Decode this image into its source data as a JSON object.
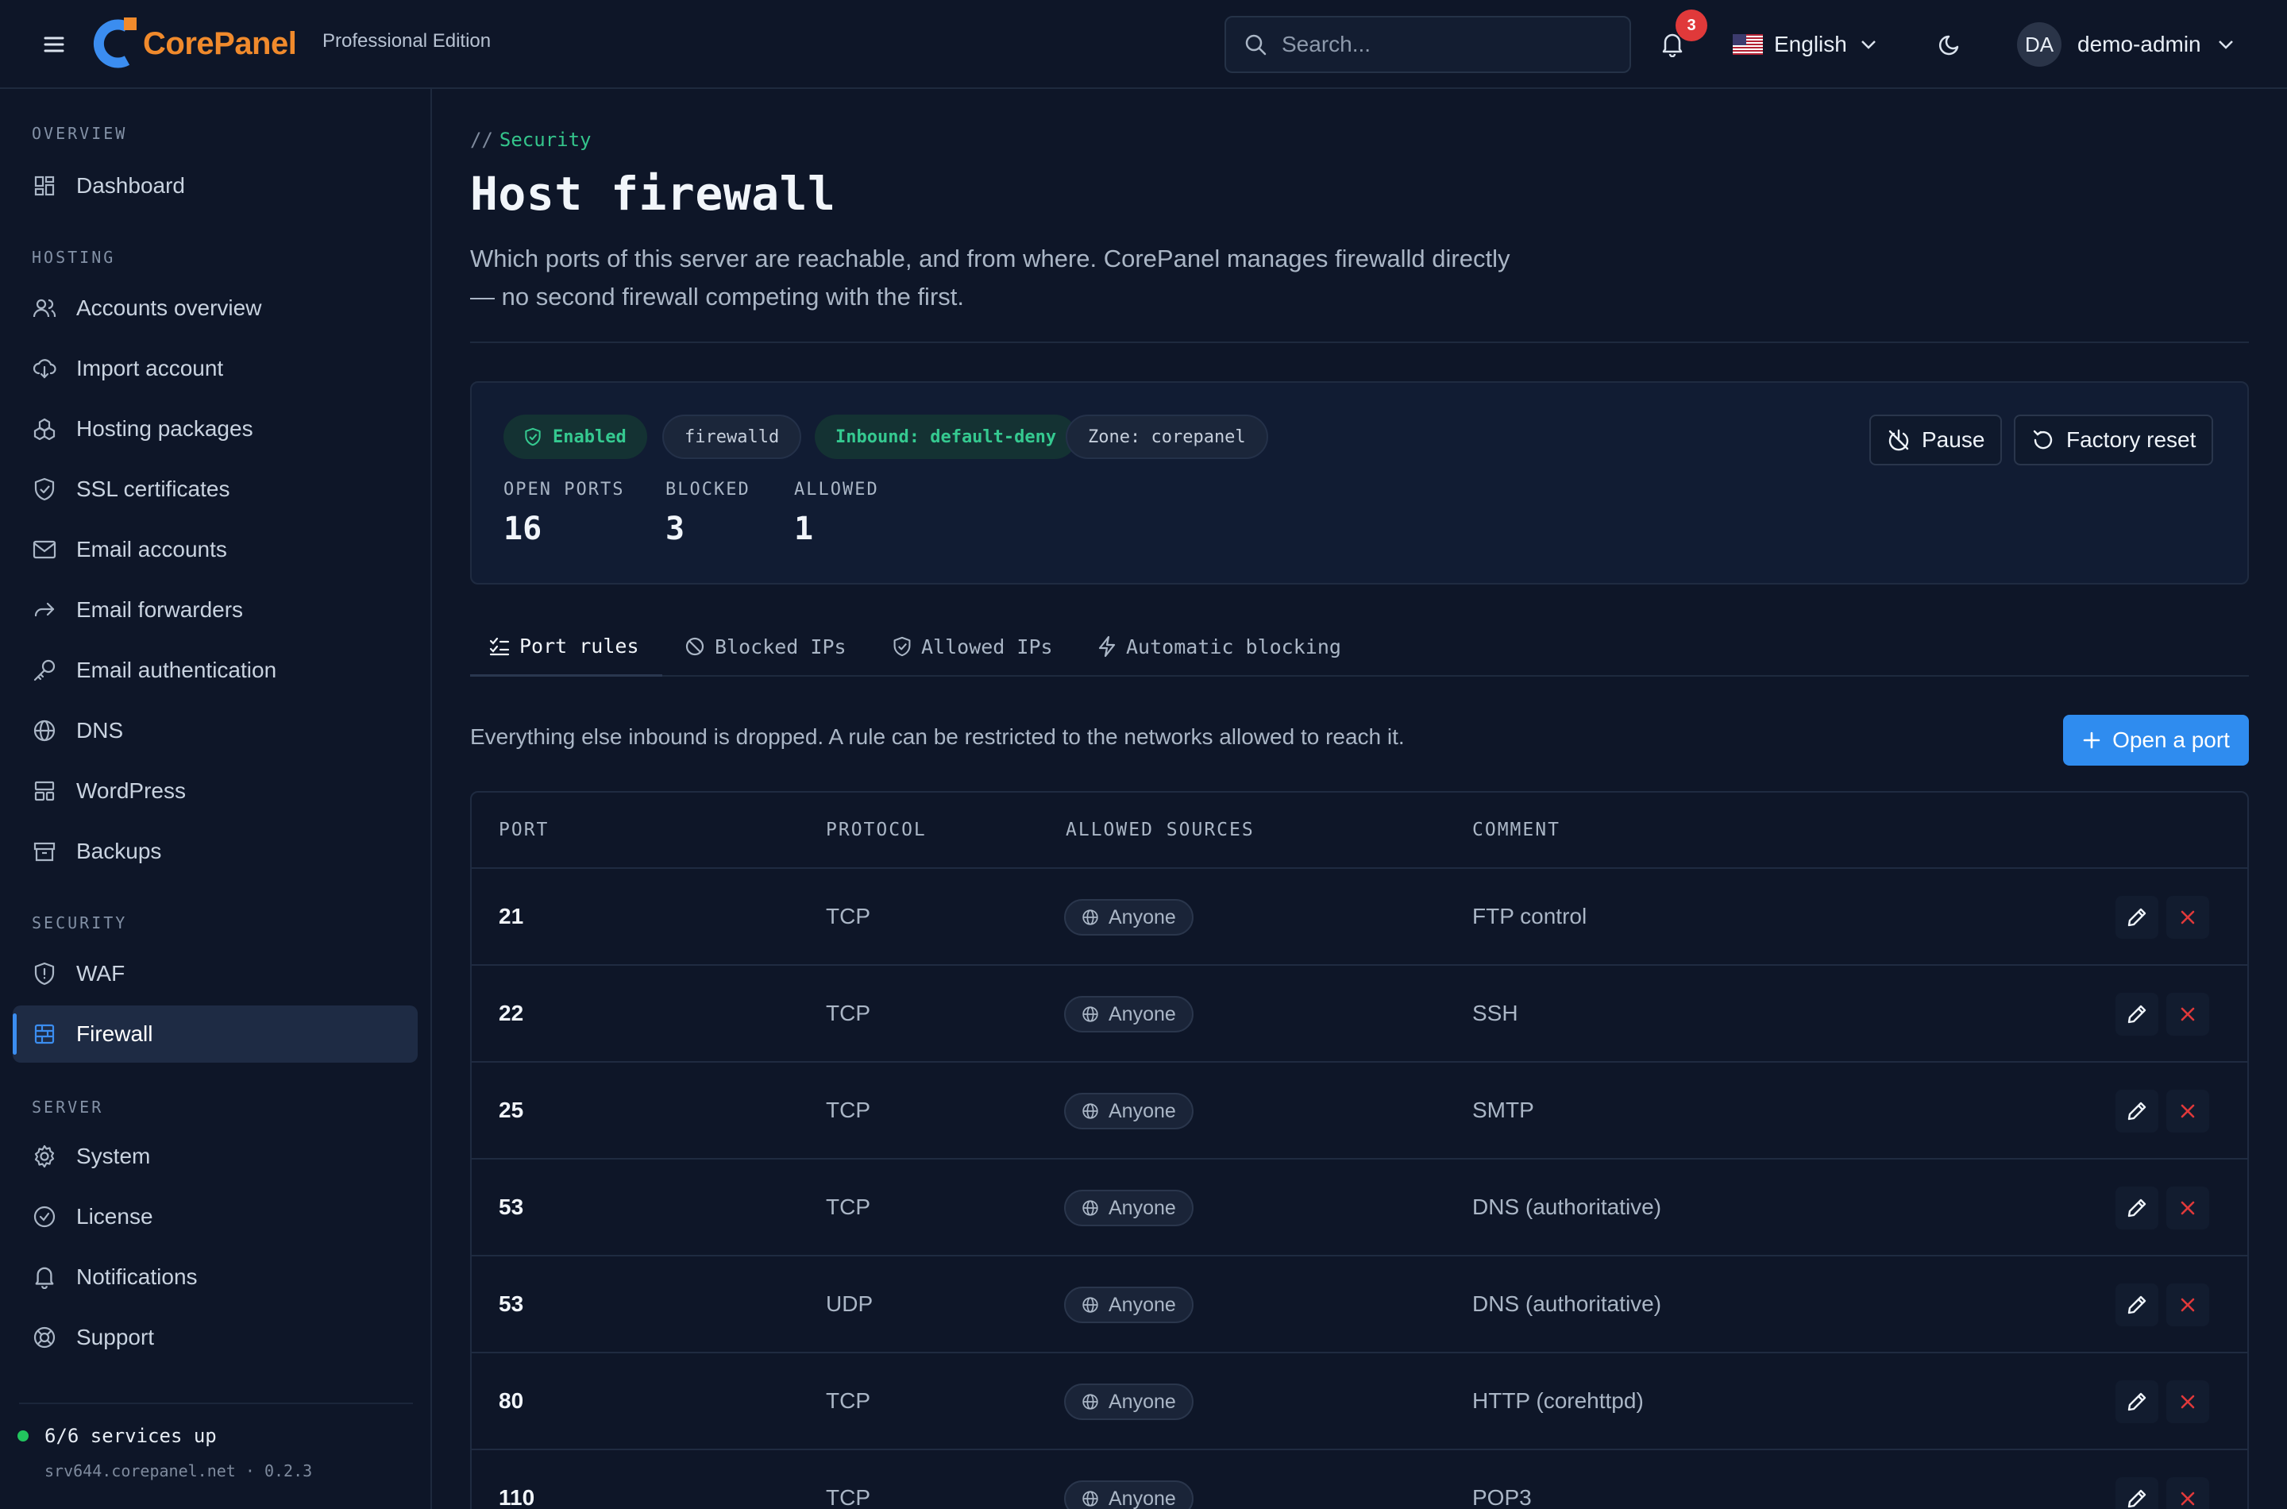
{
  "header": {
    "brand": "CorePanel",
    "edition": "Professional Edition",
    "search_placeholder": "Search...",
    "notifications_count": "3",
    "language": "English",
    "user_initials": "DA",
    "user_name": "demo-admin",
    "colors": {
      "brand_orange": "#f08a2c",
      "brand_blue": "#3b8df0",
      "badge_red": "#e0393a"
    }
  },
  "sidebar": {
    "sections": [
      {
        "title": "OVERVIEW",
        "items": [
          {
            "label": "Dashboard",
            "icon": "dashboard-icon"
          }
        ]
      },
      {
        "title": "HOSTING",
        "items": [
          {
            "label": "Accounts overview",
            "icon": "users-icon"
          },
          {
            "label": "Import account",
            "icon": "cloud-download-icon"
          },
          {
            "label": "Hosting packages",
            "icon": "packages-icon"
          },
          {
            "label": "SSL certificates",
            "icon": "shield-icon"
          },
          {
            "label": "Email accounts",
            "icon": "mail-icon"
          },
          {
            "label": "Email forwarders",
            "icon": "forward-arrow-icon"
          },
          {
            "label": "Email authentication",
            "icon": "key-icon"
          },
          {
            "label": "DNS",
            "icon": "globe-icon"
          },
          {
            "label": "WordPress",
            "icon": "layout-icon"
          },
          {
            "label": "Backups",
            "icon": "archive-icon"
          }
        ]
      },
      {
        "title": "SECURITY",
        "items": [
          {
            "label": "WAF",
            "icon": "shield-alert-icon"
          },
          {
            "label": "Firewall",
            "icon": "brick-wall-icon",
            "active": true
          }
        ]
      },
      {
        "title": "SERVER",
        "items": [
          {
            "label": "System",
            "icon": "gear-icon"
          },
          {
            "label": "License",
            "icon": "check-circle-icon"
          },
          {
            "label": "Notifications",
            "icon": "bell-icon"
          },
          {
            "label": "Support",
            "icon": "lifebuoy-icon"
          }
        ]
      }
    ],
    "status": "6/6 services up",
    "host": "srv644.corepanel.net",
    "host_sep": "·",
    "version": "0.2.3"
  },
  "page": {
    "breadcrumb_prefix": "//",
    "breadcrumb": "Security",
    "title": "Host firewall",
    "description": "Which ports of this server are reachable, and from where. CorePanel manages firewalld directly — no second firewall competing with the first."
  },
  "status_card": {
    "chips": {
      "enabled": "Enabled",
      "backend": "firewalld",
      "inbound": "Inbound: default-deny",
      "zone": "Zone: corepanel"
    },
    "stats": [
      {
        "label": "OPEN PORTS",
        "value": "16"
      },
      {
        "label": "BLOCKED",
        "value": "3"
      },
      {
        "label": "ALLOWED",
        "value": "1"
      }
    ],
    "buttons": {
      "pause": "Pause",
      "factory_reset": "Factory reset"
    }
  },
  "tabs": [
    {
      "label": "Port rules",
      "icon": "list-check-icon",
      "active": true
    },
    {
      "label": "Blocked IPs",
      "icon": "ban-icon"
    },
    {
      "label": "Allowed IPs",
      "icon": "shield-check-icon"
    },
    {
      "label": "Automatic blocking",
      "icon": "bolt-icon"
    }
  ],
  "rules": {
    "note": "Everything else inbound is dropped. A rule can be restricted to the networks allowed to reach it.",
    "add_button": "Open a port",
    "columns": [
      "PORT",
      "PROTOCOL",
      "ALLOWED SOURCES",
      "COMMENT"
    ],
    "rows": [
      {
        "port": "21",
        "protocol": "TCP",
        "sources": "Anyone",
        "comment": "FTP control"
      },
      {
        "port": "22",
        "protocol": "TCP",
        "sources": "Anyone",
        "comment": "SSH"
      },
      {
        "port": "25",
        "protocol": "TCP",
        "sources": "Anyone",
        "comment": "SMTP"
      },
      {
        "port": "53",
        "protocol": "TCP",
        "sources": "Anyone",
        "comment": "DNS (authoritative)"
      },
      {
        "port": "53",
        "protocol": "UDP",
        "sources": "Anyone",
        "comment": "DNS (authoritative)"
      },
      {
        "port": "80",
        "protocol": "TCP",
        "sources": "Anyone",
        "comment": "HTTP (corehttpd)"
      },
      {
        "port": "110",
        "protocol": "TCP",
        "sources": "Anyone",
        "comment": "POP3"
      }
    ]
  }
}
